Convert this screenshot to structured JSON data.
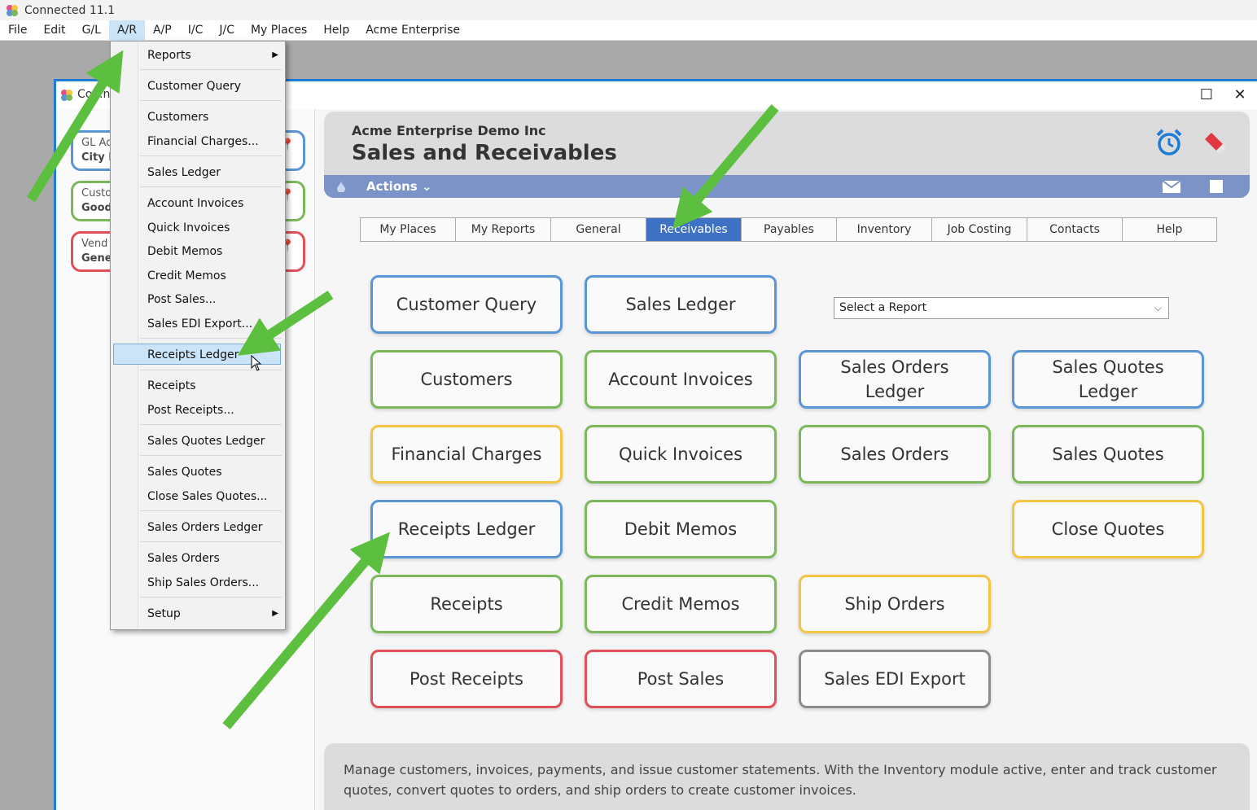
{
  "app": {
    "title": "Connected 11.1"
  },
  "menubar": [
    "File",
    "Edit",
    "G/L",
    "A/R",
    "A/P",
    "I/C",
    "J/C",
    "My Places",
    "Help",
    "Acme Enterprise"
  ],
  "inner_window": {
    "title": "Co...ne"
  },
  "side_cards": [
    {
      "line1": "GL Ac",
      "line2": "City F",
      "color": "#5a95d6"
    },
    {
      "line1": "Custo",
      "line2": "Good",
      "color": "#7bb85a"
    },
    {
      "line1": "Vend",
      "line2": "Gene",
      "color": "#e0505a"
    }
  ],
  "ar_menu": {
    "items": [
      "Reports",
      "Customer Query",
      "Customers",
      "Financial Charges...",
      "Sales Ledger",
      "Account Invoices",
      "Quick Invoices",
      "Debit Memos",
      "Credit Memos",
      "Post Sales...",
      "Sales EDI Export...",
      "Receipts Ledger",
      "Receipts",
      "Post Receipts...",
      "Sales Quotes Ledger",
      "Sales Quotes",
      "Close Sales Quotes...",
      "Sales Orders Ledger",
      "Sales Orders",
      "Ship Sales Orders...",
      "Setup"
    ],
    "highlighted": "Receipts Ledger"
  },
  "header": {
    "company": "Acme Enterprise Demo Inc",
    "title": "Sales and Receivables",
    "actions_label": "Actions ⌄"
  },
  "tabs": [
    "My Places",
    "My Reports",
    "General",
    "Receivables",
    "Payables",
    "Inventory",
    "Job Costing",
    "Contacts",
    "Help"
  ],
  "active_tab": "Receivables",
  "report_select": {
    "value": "Select a Report"
  },
  "buttons": {
    "customer_query": "Customer Query",
    "sales_ledger": "Sales Ledger",
    "customers": "Customers",
    "account_invoices": "Account Invoices",
    "sales_orders_ledger": "Sales Orders Ledger",
    "sales_quotes_ledger": "Sales Quotes Ledger",
    "financial_charges": "Financial Charges",
    "quick_invoices": "Quick Invoices",
    "sales_orders": "Sales Orders",
    "sales_quotes": "Sales Quotes",
    "receipts_ledger": "Receipts Ledger",
    "debit_memos": "Debit Memos",
    "close_quotes": "Close Quotes",
    "receipts": "Receipts",
    "credit_memos": "Credit Memos",
    "ship_orders": "Ship Orders",
    "post_receipts": "Post Receipts",
    "post_sales": "Post Sales",
    "sales_edi_export": "Sales EDI Export"
  },
  "footer": {
    "description": "Manage customers, invoices, payments, and issue customer statements. With the Inventory module active, enter and track customer quotes, convert quotes to orders, and ship orders to create customer invoices."
  },
  "colors": {
    "blue": "#5a95d6",
    "green": "#7bb85a",
    "yellow": "#f4c542",
    "red": "#e0505a",
    "gray": "#8c8c8c",
    "active_tab": "#3f72c4",
    "arrow": "#5cbf3f"
  }
}
